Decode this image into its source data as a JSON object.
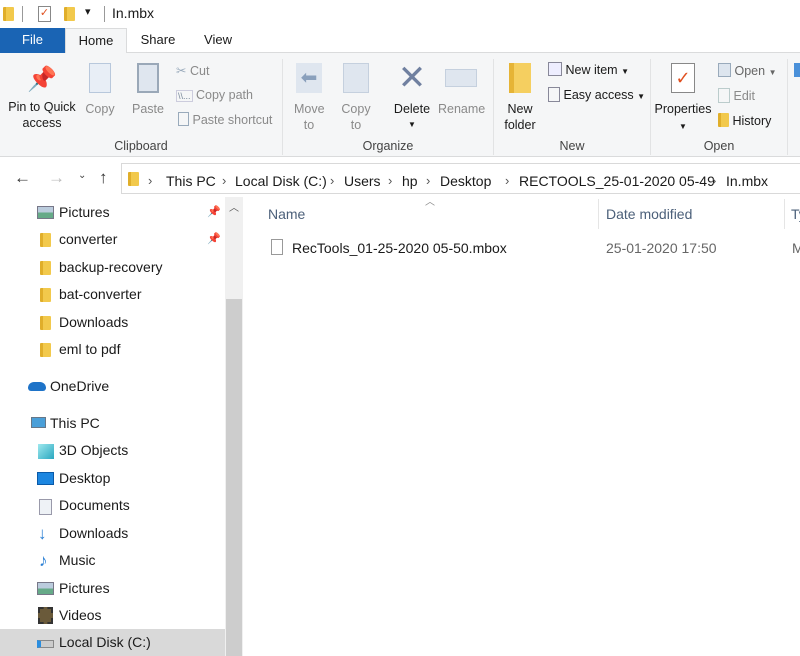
{
  "title": "In.mbx",
  "tabs": {
    "file": "File",
    "home": "Home",
    "share": "Share",
    "view": "View"
  },
  "ribbon": {
    "clipboard": {
      "label": "Clipboard",
      "pin": "Pin to Quick access",
      "copy": "Copy",
      "paste": "Paste",
      "cut": "Cut",
      "copy_path": "Copy path",
      "paste_shortcut": "Paste shortcut"
    },
    "organize": {
      "label": "Organize",
      "move_to": "Move to",
      "copy_to": "Copy to",
      "delete": "Delete",
      "rename": "Rename"
    },
    "new": {
      "label": "New",
      "new_folder": "New folder",
      "new_item": "New item",
      "easy_access": "Easy access"
    },
    "open": {
      "label": "Open",
      "properties": "Properties",
      "open": "Open",
      "edit": "Edit",
      "history": "History"
    }
  },
  "address": {
    "crumbs": [
      "This PC",
      "Local Disk (C:)",
      "Users",
      "hp",
      "Desktop",
      "RECTOOLS_25-01-2020 05-49",
      "In.mbx"
    ]
  },
  "nav": {
    "quick": [
      {
        "label": "Pictures",
        "pinned": true
      },
      {
        "label": "converter",
        "pinned": true
      },
      {
        "label": "backup-recovery"
      },
      {
        "label": "bat-converter"
      },
      {
        "label": "Downloads"
      },
      {
        "label": "eml to pdf"
      }
    ],
    "onedrive": "OneDrive",
    "thispc": "This PC",
    "pc": [
      "3D Objects",
      "Desktop",
      "Documents",
      "Downloads",
      "Music",
      "Pictures",
      "Videos",
      "Local Disk (C:)"
    ],
    "selected": "Local Disk (C:)"
  },
  "columns": {
    "name": "Name",
    "date": "Date modified",
    "type": "Ty"
  },
  "files": [
    {
      "name": "RecTools_01-25-2020 05-50.mbox",
      "date": "25-01-2020 17:50",
      "type": "M"
    }
  ],
  "colors": {
    "file_tab": "#1a64b4",
    "selected": "#d9d9d9"
  }
}
